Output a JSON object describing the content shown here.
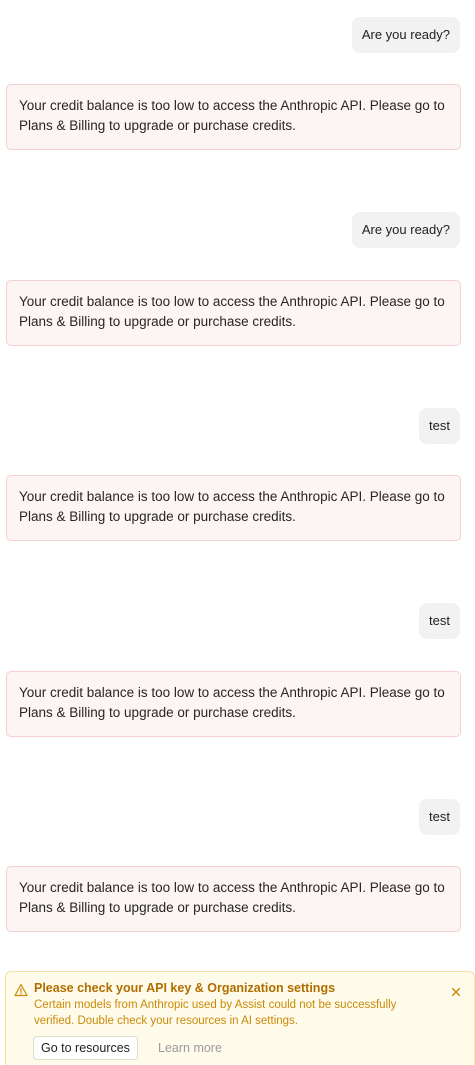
{
  "conversation": {
    "messages": [
      {
        "role": "user",
        "text": "Are you ready?"
      },
      {
        "role": "error",
        "text": "Your credit balance is too low to access the Anthropic API. Please go to Plans & Billing to upgrade or purchase credits."
      },
      {
        "role": "user",
        "text": "Are you ready?"
      },
      {
        "role": "error",
        "text": "Your credit balance is too low to access the Anthropic API. Please go to Plans & Billing to upgrade or purchase credits."
      },
      {
        "role": "user",
        "text": "test"
      },
      {
        "role": "error",
        "text": "Your credit balance is too low to access the Anthropic API. Please go to Plans & Billing to upgrade or purchase credits."
      },
      {
        "role": "user",
        "text": "test"
      },
      {
        "role": "error",
        "text": "Your credit balance is too low to access the Anthropic API. Please go to Plans & Billing to upgrade or purchase credits."
      },
      {
        "role": "user",
        "text": "test"
      },
      {
        "role": "error",
        "text": "Your credit balance is too low to access the Anthropic API. Please go to Plans & Billing to upgrade or purchase credits."
      }
    ]
  },
  "warning_banner": {
    "icon": "warning-triangle-icon",
    "title": "Please check your API key & Organization settings",
    "body": "Certain models from Anthropic used by Assist could not be successfully verified. Double check your resources in AI settings.",
    "primary_label": "Go to resources",
    "secondary_label": "Learn more",
    "close_icon": "close-icon"
  },
  "colors": {
    "error_background": "#fdf4f4",
    "error_border": "#f3cfcf",
    "user_bubble": "#f2f2f2",
    "banner_background": "#fffbea",
    "banner_title": "#b06e00",
    "banner_text": "#c98a0a"
  }
}
